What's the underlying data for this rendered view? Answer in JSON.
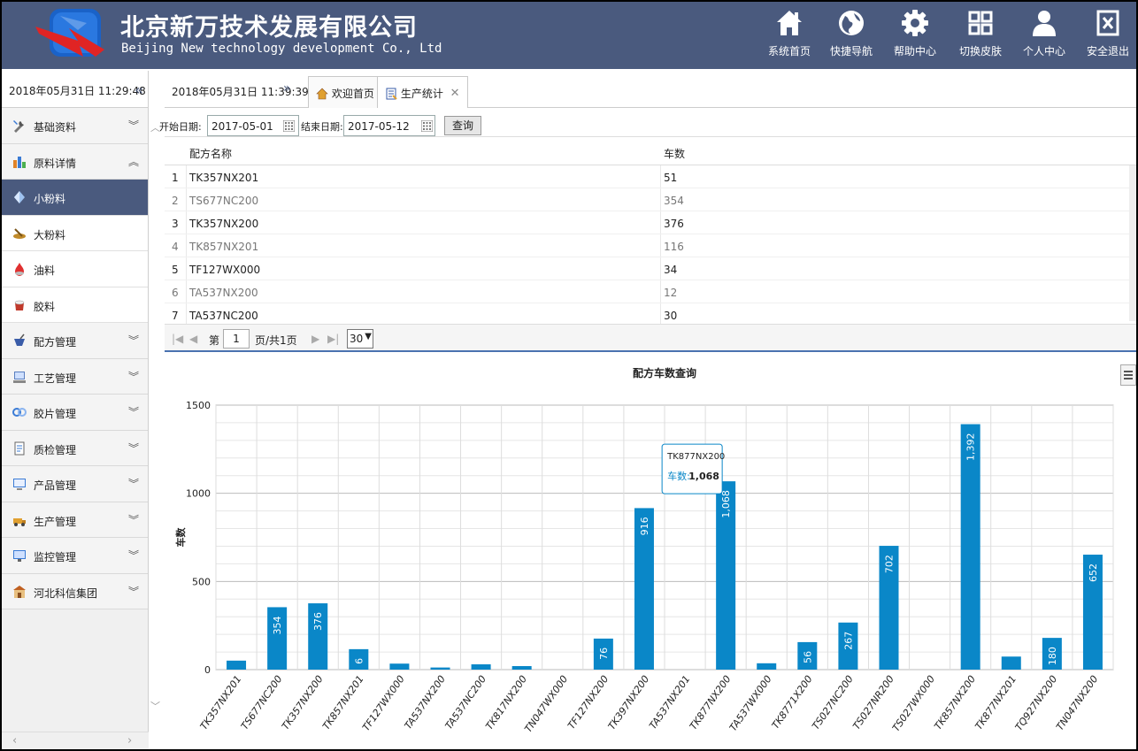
{
  "header": {
    "company_cn": "北京新万技术发展有限公司",
    "company_en": "Beijing New technology development Co., Ltd",
    "nav": [
      {
        "label": "系统首页",
        "icon": "home-icon"
      },
      {
        "label": "快捷导航",
        "icon": "globe-icon"
      },
      {
        "label": "帮助中心",
        "icon": "gear-icon"
      },
      {
        "label": "切换皮肤",
        "icon": "grid-icon"
      },
      {
        "label": "个人中心",
        "icon": "user-icon"
      },
      {
        "label": "安全退出",
        "icon": "exit-icon"
      }
    ]
  },
  "sidebar": {
    "datetime": "2018年05月31日 11:29:48",
    "collapse": "«",
    "menus": [
      {
        "label": "基础资料",
        "chevron": "︾",
        "icon": "tools-icon"
      },
      {
        "label": "原料详情",
        "chevron": "︽",
        "icon": "materials-icon"
      },
      {
        "label": "配方管理",
        "chevron": "︾",
        "icon": "formula-icon"
      },
      {
        "label": "工艺管理",
        "chevron": "︾",
        "icon": "process-icon"
      },
      {
        "label": "胶片管理",
        "chevron": "︾",
        "icon": "film-icon"
      },
      {
        "label": "质检管理",
        "chevron": "︾",
        "icon": "inspection-icon"
      },
      {
        "label": "产品管理",
        "chevron": "︾",
        "icon": "product-icon"
      },
      {
        "label": "生产管理",
        "chevron": "︾",
        "icon": "production-icon"
      },
      {
        "label": "监控管理",
        "chevron": "︾",
        "icon": "monitor-icon"
      },
      {
        "label": "河北科信集团",
        "chevron": "︾",
        "icon": "company-icon"
      }
    ],
    "submenus": [
      {
        "label": "小粉料",
        "icon": "small-powder-icon"
      },
      {
        "label": "大粉料",
        "icon": "large-powder-icon"
      },
      {
        "label": "油料",
        "icon": "oil-icon"
      },
      {
        "label": "胶料",
        "icon": "rubber-icon"
      }
    ]
  },
  "tabbar": {
    "datetime": "2018年05月31日 11:39:39",
    "expand": "»",
    "tabs": [
      {
        "label": "欢迎首页",
        "icon": "home-tab-icon"
      },
      {
        "label": "生产统计",
        "icon": "report-tab-icon",
        "close": "✕"
      }
    ]
  },
  "filter": {
    "start_label": "开始日期:",
    "start_value": "2017-05-01",
    "end_label": "结束日期:",
    "end_value": "2017-05-12",
    "query_label": "查询"
  },
  "grid": {
    "columns": [
      "配方名称",
      "车数"
    ],
    "rows": [
      [
        "1",
        "TK357NX201",
        "51"
      ],
      [
        "2",
        "TS677NC200",
        "354"
      ],
      [
        "3",
        "TK357NX200",
        "376"
      ],
      [
        "4",
        "TK857NX201",
        "116"
      ],
      [
        "5",
        "TF127WX000",
        "34"
      ],
      [
        "6",
        "TA537NX200",
        "12"
      ],
      [
        "7",
        "TA537NC200",
        "30"
      ]
    ]
  },
  "pager": {
    "prefix": "第",
    "page": "1",
    "suffix": "页/共1页",
    "page_size": "30"
  },
  "chart_data": {
    "type": "bar",
    "title": "配方车数查询",
    "ylabel": "车数",
    "xlabel": "",
    "ylim": [
      0,
      1500
    ],
    "yticks": [
      0,
      500,
      1000,
      1500
    ],
    "color": "#0a87c8",
    "categories": [
      "TK357NX201",
      "TS677NC200",
      "TK357NX200",
      "TK857NX201",
      "TF127WX000",
      "TA537NX200",
      "TA537NC200",
      "TK817NX200",
      "TN047WX000",
      "TF127NX200",
      "TK397NX200",
      "TA537NX201",
      "TK877NX200",
      "TA537WX000",
      "TK8771X200",
      "TS027NC200",
      "TS027NR200",
      "TS027WX000",
      "TK857NX200",
      "TK877NX201",
      "TQ927NX200",
      "TN047NX200"
    ],
    "values": [
      51,
      354,
      376,
      116,
      34,
      12,
      30,
      20,
      0,
      176,
      916,
      0,
      1068,
      36,
      156,
      267,
      702,
      0,
      1392,
      74,
      180,
      652
    ],
    "data_labels": [
      "",
      "354",
      "376",
      "6",
      "",
      "",
      "",
      "",
      "",
      "76",
      "916",
      "",
      "1,068",
      "",
      "56",
      "267",
      "702",
      "",
      "1,392",
      "",
      "180",
      "652"
    ],
    "tooltip": {
      "category": "TK877NX200",
      "series_label": "车数:",
      "value": "1,068"
    }
  }
}
